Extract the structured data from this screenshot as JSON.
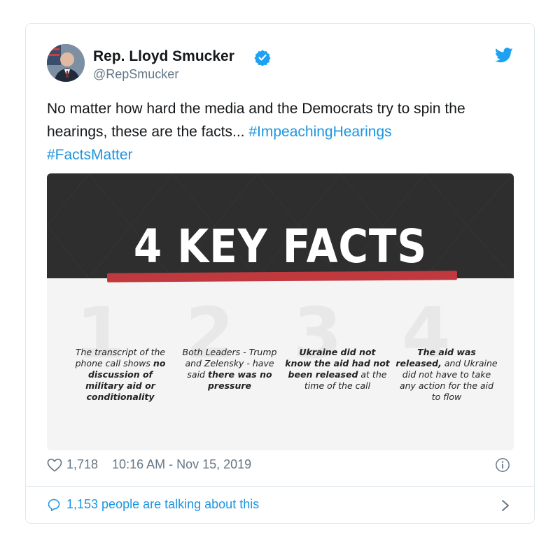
{
  "tweet": {
    "author_name": "Rep. Lloyd Smucker",
    "handle": "@RepSmucker",
    "text_plain": "No matter how hard the media and the Democrats try to spin the hearings, these are the facts...",
    "hashtag_1": "#ImpeachingHearings",
    "hashtag_2": "#FactsMatter",
    "likes": "1,718",
    "timestamp": "10:16 AM - Nov 15, 2019",
    "talking": "1,153 people are talking about this"
  },
  "media": {
    "title": "4 KEY FACTS",
    "numbers": [
      "1",
      "2",
      "3",
      "4"
    ],
    "facts": [
      {
        "pre": "The transcript of the phone call shows ",
        "bold": "no discussion of military aid or conditionality",
        "post": ""
      },
      {
        "pre": "Both Leaders - Trump and Zelensky - have said ",
        "bold": "there was no pressure",
        "post": ""
      },
      {
        "pre": "",
        "bold": "Ukraine did not know the aid had not been released",
        "post": " at the time of the call"
      },
      {
        "pre": "",
        "bold": "The aid was released,",
        "post": " and Ukraine did not have to take any action for the aid to flow"
      }
    ]
  },
  "icons": [
    "verified-badge-icon",
    "twitter-bird-icon",
    "heart-icon",
    "info-icon",
    "comment-bubble-icon",
    "chevron-right-icon"
  ],
  "colors": {
    "link": "#1b95e0",
    "muted": "#657786",
    "accent_red": "#c0393f",
    "banner": "#2e2e2e"
  }
}
